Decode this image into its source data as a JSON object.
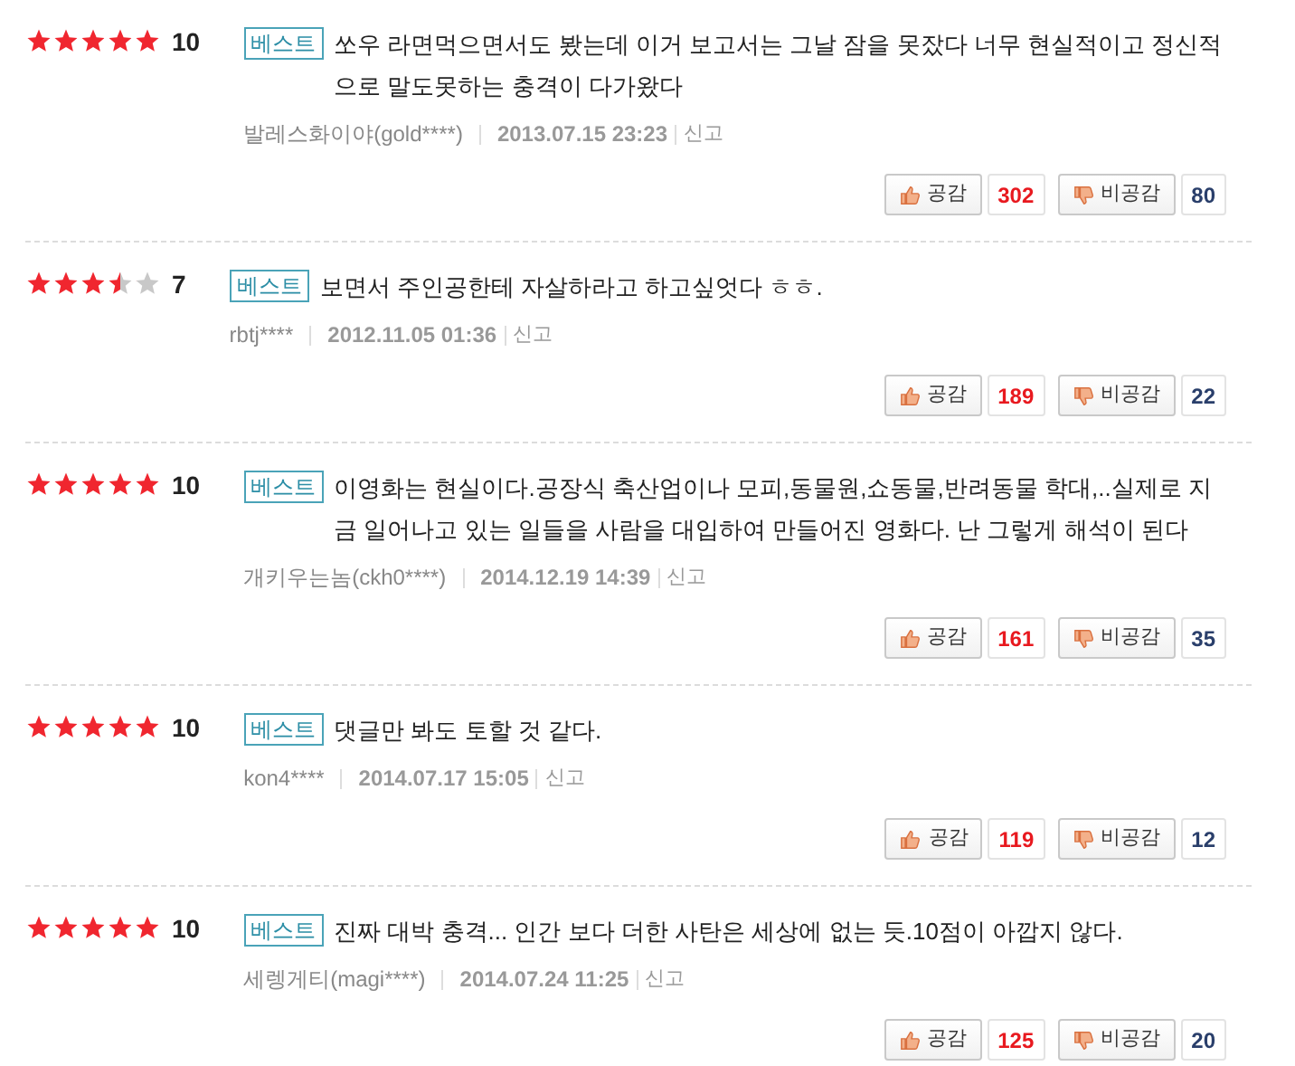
{
  "reviews": [
    {
      "stars": 5,
      "score": "10",
      "badge": "베스트",
      "text": "쏘우 라면먹으면서도 봤는데 이거 보고서는 그날 잠을 못잤다 너무 현실적이고 정신적으로 말도못하는 충격이 다가왔다",
      "author": "발레스화이야(gold****)",
      "date": "2013.07.15 23:23",
      "report": "신고",
      "like": {
        "label": "공감",
        "count": "302"
      },
      "dislike": {
        "label": "비공감",
        "count": "80"
      }
    },
    {
      "stars": 3.5,
      "score": "7",
      "badge": "베스트",
      "text": "보면서 주인공한테 자살하라고 하고싶엇다 ㅎㅎ.",
      "author": "rbtj****",
      "date": "2012.11.05 01:36",
      "report": "신고",
      "like": {
        "label": "공감",
        "count": "189"
      },
      "dislike": {
        "label": "비공감",
        "count": "22"
      }
    },
    {
      "stars": 5,
      "score": "10",
      "badge": "베스트",
      "text": "이영화는 현실이다.공장식 축산업이나 모피,동물원,쇼동물,반려동물 학대,..실제로 지금 일어나고 있는 일들을 사람을 대입하여 만들어진 영화다. 난 그렇게 해석이 된다",
      "author": "개키우는놈(ckh0****)",
      "date": "2014.12.19 14:39",
      "report": "신고",
      "like": {
        "label": "공감",
        "count": "161"
      },
      "dislike": {
        "label": "비공감",
        "count": "35"
      }
    },
    {
      "stars": 5,
      "score": "10",
      "badge": "베스트",
      "text": "댓글만 봐도 토할 것 같다.",
      "author": "kon4****",
      "date": "2014.07.17 15:05",
      "report": "신고",
      "like": {
        "label": "공감",
        "count": "119"
      },
      "dislike": {
        "label": "비공감",
        "count": "12"
      }
    },
    {
      "stars": 5,
      "score": "10",
      "badge": "베스트",
      "text": "진짜 대박 충격... 인간 보다 더한 사탄은 세상에 없는 듯.10점이 아깝지 않다.",
      "author": "세렝게티(magi****)",
      "date": "2014.07.24 11:25",
      "report": "신고",
      "like": {
        "label": "공감",
        "count": "125"
      },
      "dislike": {
        "label": "비공감",
        "count": "20"
      }
    }
  ]
}
